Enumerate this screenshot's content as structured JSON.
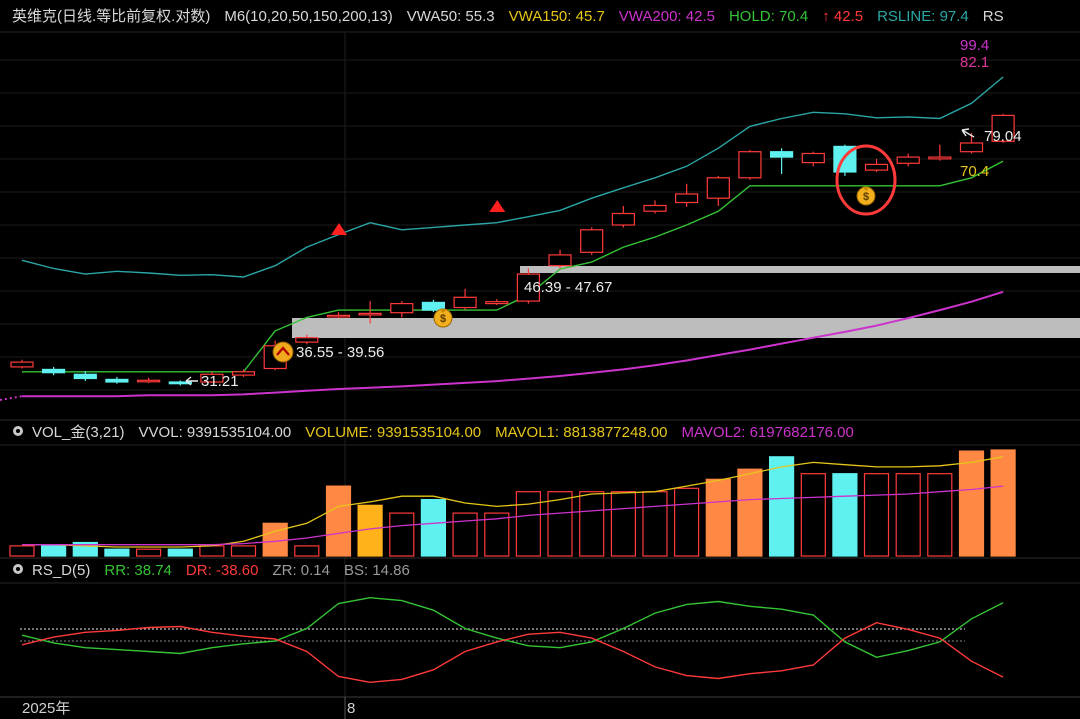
{
  "panels": {
    "main": {
      "header": [
        {
          "text": "英维克(日线.等比前复权.对数)",
          "color": "#d8d8d8"
        },
        {
          "text": "M6(10,20,50,150,200,13)",
          "color": "#d8d8d8"
        },
        {
          "text": "VWA50: 55.3",
          "color": "#d8d8d8"
        },
        {
          "text": "VWA150: 45.7",
          "color": "#e6c619"
        },
        {
          "text": "VWA200: 42.5",
          "color": "#cc33cc"
        },
        {
          "text": "HOLD: 70.4",
          "color": "#35c435"
        },
        {
          "text": "↑ 42.5",
          "color": "#ff3a3a"
        },
        {
          "text": "RSLINE: 97.4",
          "color": "#2ba6a6"
        },
        {
          "text": "RS",
          "color": "#d8d8d8"
        }
      ]
    },
    "volume": {
      "header": [
        {
          "text": "VOL_金(3,21)",
          "color": "#d8d8d8"
        },
        {
          "text": "VVOL: 9391535104.00",
          "color": "#d8d8d8"
        },
        {
          "text": "VOLUME: 9391535104.00",
          "color": "#e6c619"
        },
        {
          "text": "MAVOL1: 8813877248.00",
          "color": "#e6c619"
        },
        {
          "text": "MAVOL2: 6197682176.00",
          "color": "#cc33cc"
        }
      ]
    },
    "rs": {
      "header": [
        {
          "text": "RS_D(5)",
          "color": "#d8d8d8"
        },
        {
          "text": "RR: 38.74",
          "color": "#35c435"
        },
        {
          "text": "DR: -38.60",
          "color": "#ff3a3a"
        },
        {
          "text": "ZR: 0.14",
          "color": "#9a9a9a"
        },
        {
          "text": "BS: 14.86",
          "color": "#9a9a9a"
        }
      ]
    }
  },
  "time_axis": {
    "labels": [
      "2025年",
      "8"
    ]
  },
  "chart_data": [
    {
      "type": "candlestick",
      "panel": "price",
      "scale": "log",
      "ylim": [
        30,
        100
      ],
      "candles": [
        {
          "o": 31.8,
          "c": 32.4,
          "h": 32.7,
          "l": 31.6
        },
        {
          "o": 31.5,
          "c": 31.1,
          "h": 31.8,
          "l": 30.8
        },
        {
          "o": 30.9,
          "c": 30.4,
          "h": 31.3,
          "l": 30.1
        },
        {
          "o": 30.3,
          "c": 30.0,
          "h": 30.6,
          "l": 29.8
        },
        {
          "o": 30.2,
          "c": 30.2,
          "h": 30.5,
          "l": 29.9
        },
        {
          "o": 30.0,
          "c": 29.8,
          "h": 30.2,
          "l": 29.6
        },
        {
          "o": 30.0,
          "c": 30.9,
          "h": 31.2,
          "l": 29.9
        },
        {
          "o": 30.8,
          "c": 31.2,
          "h": 31.5,
          "l": 30.6
        },
        {
          "o": 31.6,
          "c": 34.5,
          "h": 35.2,
          "l": 31.4
        },
        {
          "o": 35.0,
          "c": 35.6,
          "h": 36.0,
          "l": 34.7
        },
        {
          "o": 38.8,
          "c": 38.8,
          "h": 39.3,
          "l": 38.4
        },
        {
          "o": 39.1,
          "c": 39.1,
          "h": 41.0,
          "l": 37.6
        },
        {
          "o": 39.2,
          "c": 40.6,
          "h": 41.0,
          "l": 38.5
        },
        {
          "o": 40.8,
          "c": 39.6,
          "h": 41.2,
          "l": 39.3
        },
        {
          "o": 40.0,
          "c": 41.6,
          "h": 43.0,
          "l": 39.7
        },
        {
          "o": 40.6,
          "c": 40.9,
          "h": 41.3,
          "l": 40.4
        },
        {
          "o": 41.0,
          "c": 45.5,
          "h": 46.5,
          "l": 40.6
        },
        {
          "o": 47.0,
          "c": 49.0,
          "h": 50.0,
          "l": 46.5
        },
        {
          "o": 49.5,
          "c": 54.0,
          "h": 54.5,
          "l": 49.0
        },
        {
          "o": 55.0,
          "c": 57.5,
          "h": 59.2,
          "l": 54.5
        },
        {
          "o": 58.0,
          "c": 59.3,
          "h": 60.5,
          "l": 57.5
        },
        {
          "o": 60.0,
          "c": 62.0,
          "h": 64.5,
          "l": 59.0
        },
        {
          "o": 61.0,
          "c": 66.0,
          "h": 66.5,
          "l": 59.2
        },
        {
          "o": 66.0,
          "c": 73.0,
          "h": 73.5,
          "l": 65.5
        },
        {
          "o": 73.0,
          "c": 71.5,
          "h": 74.0,
          "l": 67.0
        },
        {
          "o": 70.0,
          "c": 72.5,
          "h": 73.0,
          "l": 69.0
        },
        {
          "o": 74.5,
          "c": 67.5,
          "h": 75.0,
          "l": 66.5
        },
        {
          "o": 68.0,
          "c": 69.5,
          "h": 71.0,
          "l": 67.5
        },
        {
          "o": 69.8,
          "c": 71.5,
          "h": 72.5,
          "l": 69.0
        },
        {
          "o": 71.0,
          "c": 71.5,
          "h": 75.0,
          "l": 70.5
        },
        {
          "o": 73.0,
          "c": 75.5,
          "h": 78.5,
          "l": 72.5
        },
        {
          "o": 76.0,
          "c": 84.0,
          "h": 84.5,
          "l": 75.5
        }
      ],
      "lines": [
        {
          "name": "HOLD",
          "color": "#35c435",
          "values": [
            31.2,
            31.2,
            31.2,
            31.2,
            31.2,
            31.2,
            31.2,
            31.2,
            36.55,
            38.5,
            39.6,
            39.6,
            39.6,
            39.6,
            39.6,
            39.6,
            42.0,
            46.39,
            47.67,
            50.5,
            52.5,
            55.0,
            58.0,
            64.0,
            64.0,
            64.0,
            64.0,
            64.0,
            64.0,
            64.0,
            66.0,
            70.4
          ]
        },
        {
          "name": "RSLINE",
          "color": "#2ba6a6",
          "values": [
            48.0,
            46.5,
            45.5,
            46.0,
            45.7,
            45.3,
            45.4,
            45.0,
            47.0,
            50.5,
            53.0,
            55.5,
            54.0,
            54.5,
            55.0,
            55.5,
            56.8,
            58.2,
            61.0,
            63.5,
            66.0,
            69.0,
            74.0,
            80.5,
            83.0,
            85.0,
            84.5,
            83.2,
            83.5,
            83.0,
            88.0,
            97.4
          ]
        },
        {
          "name": "VWA200",
          "color": "#cc33cc",
          "values": [
            28.4,
            28.4,
            28.4,
            28.4,
            28.5,
            28.5,
            28.5,
            28.6,
            28.8,
            29.0,
            29.2,
            29.35,
            29.5,
            29.7,
            29.9,
            30.1,
            30.4,
            30.7,
            31.1,
            31.5,
            32.0,
            32.6,
            33.3,
            34.0,
            34.8,
            35.6,
            36.4,
            37.3,
            38.4,
            39.6,
            40.9,
            42.5
          ]
        }
      ],
      "annotations": [
        {
          "text": "31.21",
          "kind": "low",
          "candle": 5
        },
        {
          "text": "36.55 - 39.56",
          "kind": "zone-start",
          "candle": 8
        },
        {
          "text": "46.39 - 47.67",
          "kind": "zone-start",
          "candle": 15
        },
        {
          "text": "79.04",
          "kind": "high",
          "candle": 31
        },
        {
          "text": "70.4",
          "kind": "hold",
          "candle": 31
        },
        {
          "text": "99.4",
          "kind": "rs-label"
        },
        {
          "text": "82.1",
          "kind": "rs-label"
        }
      ]
    },
    {
      "type": "bar",
      "panel": "volume",
      "values": [
        0.9,
        0.9,
        1.2,
        0.6,
        0.6,
        0.6,
        0.9,
        0.9,
        2.9,
        0.9,
        6.2,
        4.5,
        3.8,
        5.0,
        3.8,
        3.8,
        5.7,
        5.7,
        5.7,
        5.7,
        5.7,
        6.0,
        6.8,
        7.7,
        8.8,
        7.3,
        7.3,
        7.3,
        7.3,
        7.3,
        9.3,
        9.4
      ],
      "ylim": [
        0,
        9.4
      ],
      "unit": "billion (approx.)",
      "lines": [
        {
          "name": "MAVOL1",
          "color": "#e6c619",
          "values": [
            1.0,
            1.0,
            0.9,
            0.8,
            0.8,
            0.8,
            0.9,
            1.3,
            2.2,
            2.9,
            4.4,
            4.8,
            5.3,
            5.3,
            4.7,
            4.4,
            4.6,
            5.0,
            5.5,
            5.6,
            5.7,
            6.2,
            6.7,
            7.3,
            7.9,
            8.3,
            8.1,
            7.9,
            7.9,
            8.0,
            8.3,
            8.8
          ]
        },
        {
          "name": "MAVOL2",
          "color": "#cc33cc",
          "values": [
            1.0,
            1.0,
            1.0,
            1.0,
            1.0,
            1.0,
            1.0,
            1.1,
            1.3,
            1.6,
            2.0,
            2.4,
            2.7,
            2.9,
            3.1,
            3.3,
            3.6,
            3.8,
            4.0,
            4.2,
            4.4,
            4.6,
            4.8,
            5.0,
            5.1,
            5.2,
            5.3,
            5.4,
            5.5,
            5.7,
            5.9,
            6.2
          ]
        }
      ]
    },
    {
      "type": "line",
      "panel": "rs",
      "ylim": [
        -50,
        50
      ],
      "series": [
        {
          "name": "RR",
          "color": "#35c435",
          "values": [
            5,
            -3,
            -8,
            -10,
            -12,
            -14,
            -8,
            -4,
            -1,
            12,
            38,
            44,
            41,
            31,
            12,
            2,
            -6,
            -8,
            -2,
            12,
            28,
            37,
            40,
            35,
            32,
            26,
            -2,
            -18,
            -11,
            -2,
            22,
            38.74
          ]
        },
        {
          "name": "DR",
          "color": "#ff3a3a",
          "values": [
            -5,
            3,
            8,
            10,
            13,
            14,
            8,
            4,
            1,
            -12,
            -38,
            -44,
            -41,
            -31,
            -12,
            -2,
            6,
            8,
            2,
            -12,
            -28,
            -37,
            -40,
            -35,
            -32,
            -26,
            2,
            18,
            11,
            2,
            -22,
            -38.6
          ]
        }
      ],
      "reference_lines": [
        14.86,
        0.14
      ]
    }
  ]
}
